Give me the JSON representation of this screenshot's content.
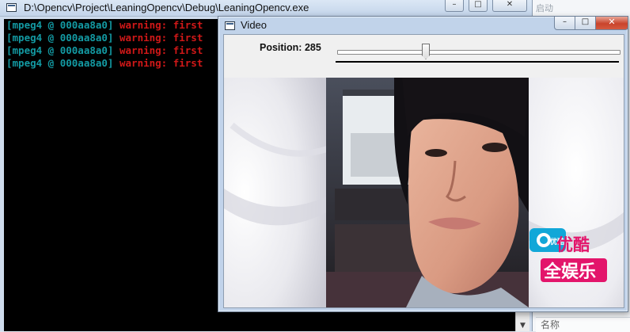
{
  "console": {
    "title": "D:\\Opencv\\Project\\LeaningOpencv\\Debug\\LeaningOpencv.exe",
    "controls": {
      "minimize": "–",
      "maximize": "□",
      "close": "✕"
    },
    "lines": [
      {
        "prefix": "[mpeg4 @ 000aa8a0]",
        "message": "warning: first"
      },
      {
        "prefix": "[mpeg4 @ 000aa8a0]",
        "message": "warning: first"
      },
      {
        "prefix": "[mpeg4 @ 000aa8a0]",
        "message": "warning: first"
      },
      {
        "prefix": "[mpeg4 @ 000aa8a0]",
        "message": "warning: first"
      }
    ],
    "colors": {
      "prefix": "#139aa3",
      "message": "#d01818",
      "background": "#000000"
    }
  },
  "video_window": {
    "title": "Video",
    "controls": {
      "minimize": "–",
      "maximize": "□",
      "close": "✕"
    },
    "trackbar": {
      "label": "Position: 285"
    },
    "watermark": {
      "line1": "优酷",
      "line2": "全娱乐",
      "badge": "优酷C"
    }
  },
  "side_panel": {
    "launch_label": "启动",
    "column_header": "名称"
  },
  "icons": {
    "console_app": "console-window-icon",
    "video_app": "opencv-window-icon",
    "scroll_down": "scroll-down-arrow-icon"
  }
}
